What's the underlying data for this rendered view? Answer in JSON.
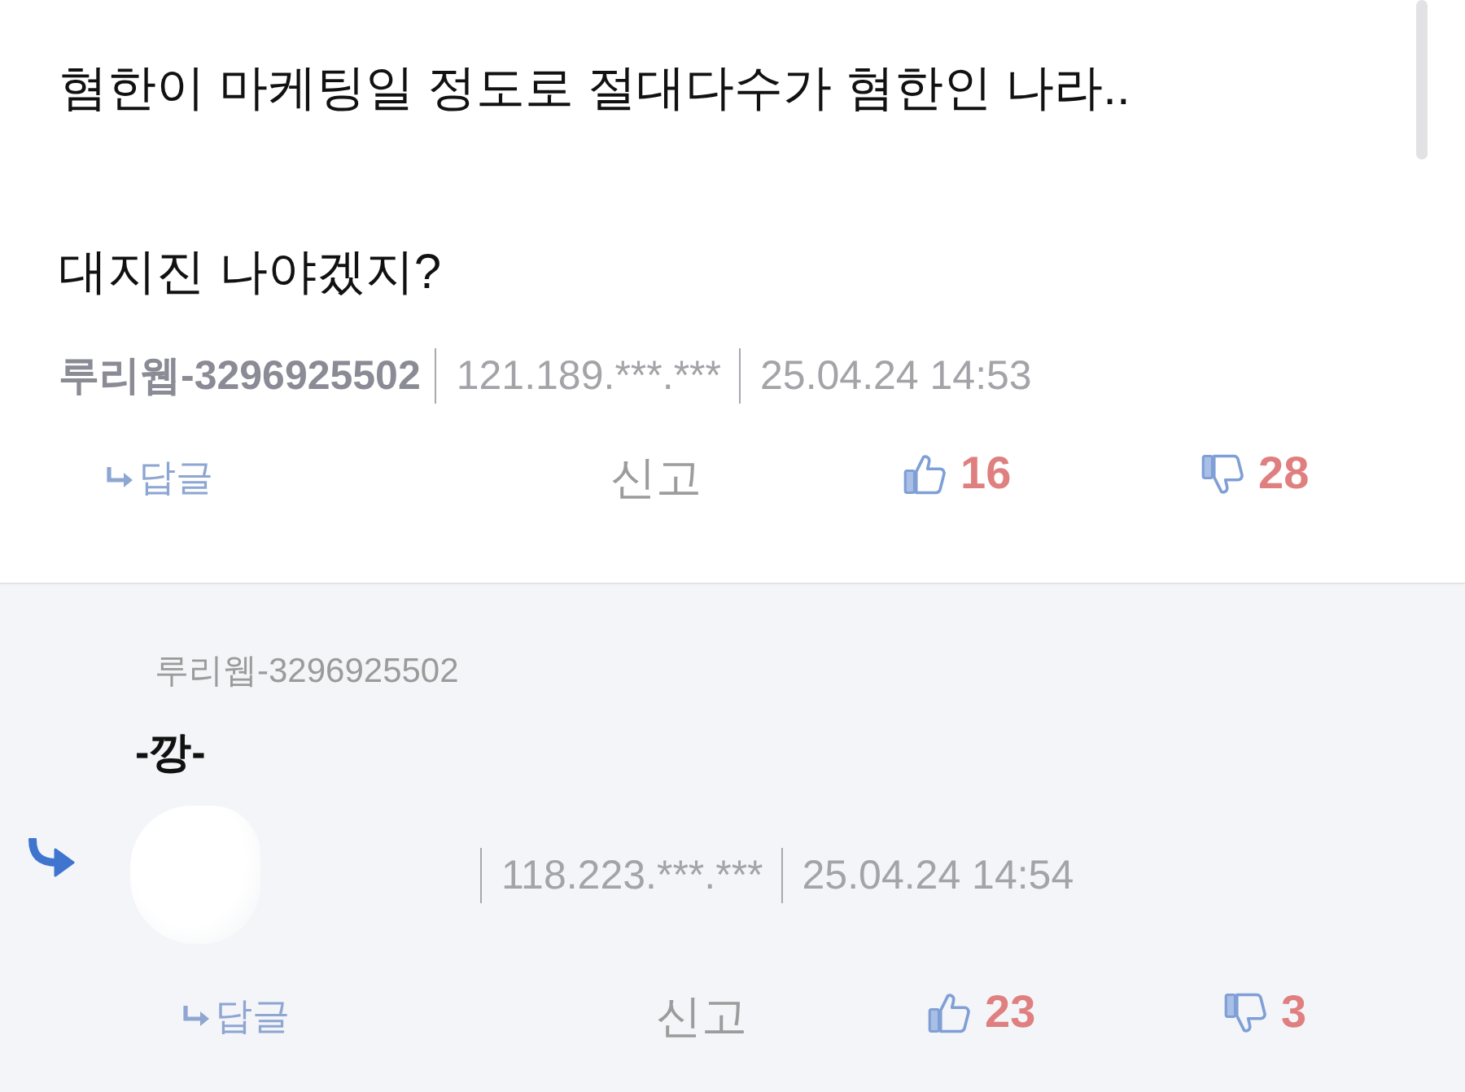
{
  "comments": [
    {
      "kind": "comment",
      "paragraphs": [
        "혐한이 마케팅일 정도로 절대다수가 혐한인 나라..",
        "대지진 나야겠지?"
      ],
      "author": "루리웹-3296925502",
      "ip": "121.189.***.***",
      "date": "25.04.24 14:53",
      "actions": {
        "reply": "답글",
        "report": "신고",
        "likes": "16",
        "dislikes": "28"
      }
    },
    {
      "kind": "reply",
      "quoted_author": "루리웹-3296925502",
      "paragraphs": [
        "-깡-"
      ],
      "ip": "118.223.***.***",
      "date": "25.04.24 14:54",
      "actions": {
        "reply": "답글",
        "report": "신고",
        "likes": "23",
        "dislikes": "3"
      }
    }
  ]
}
